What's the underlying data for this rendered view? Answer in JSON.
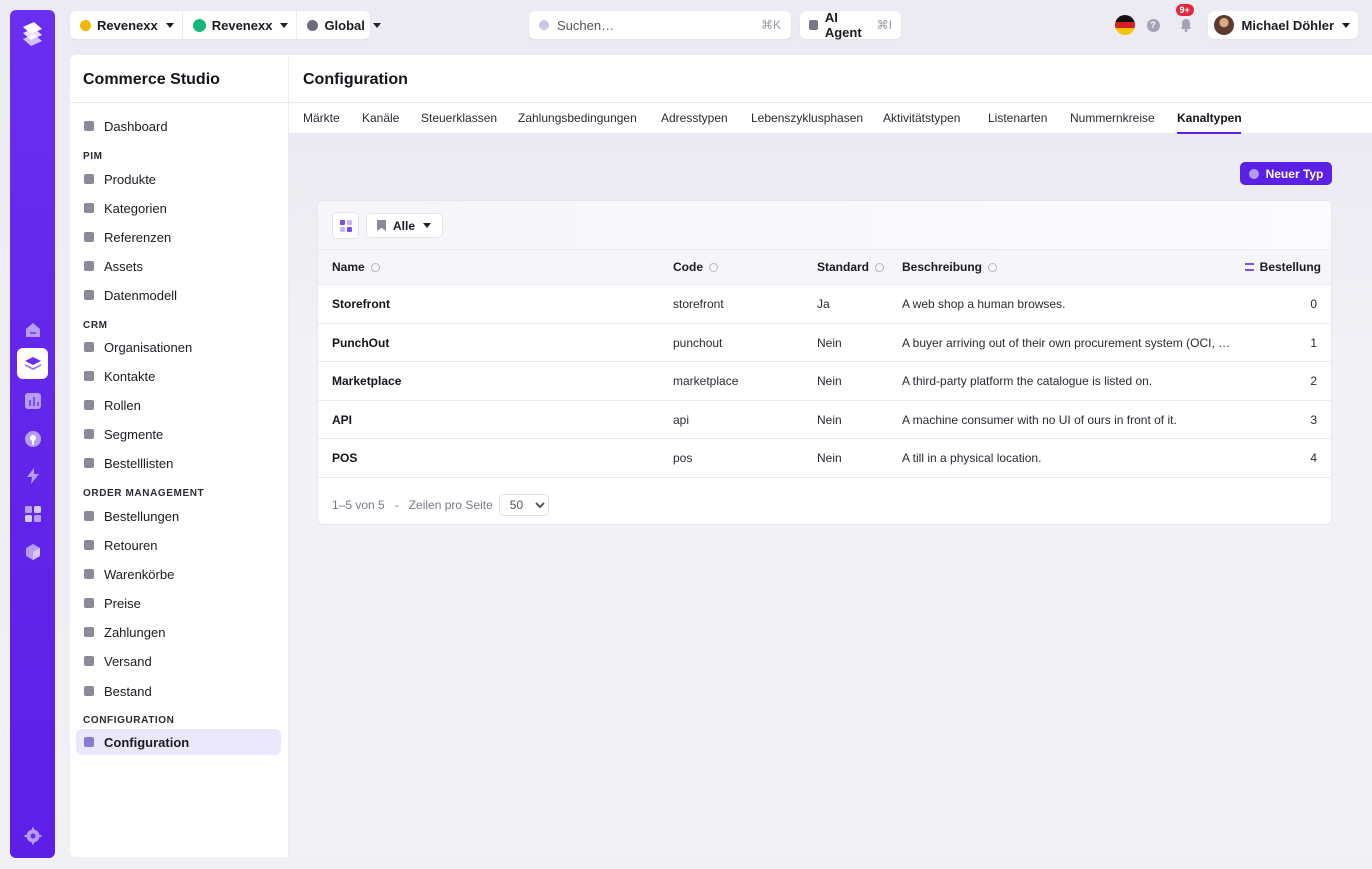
{
  "topbar": {
    "context": [
      {
        "label": "Revenexx",
        "color": "#f2b705"
      },
      {
        "label": "Revenexx",
        "color": "#14b87a"
      },
      {
        "label": "Global",
        "color": "#6e6c7a"
      }
    ],
    "search_placeholder": "Suchen…",
    "search_shortcut": "⌘K",
    "agent_label": "AI Agent",
    "agent_shortcut": "⌘I",
    "notification_badge": "9+",
    "help_icon": "?",
    "user_name": "Michael Döhler"
  },
  "sidebar": {
    "title": "Commerce Studio",
    "dashboard": "Dashboard",
    "sections": [
      {
        "heading": "PIM",
        "items": [
          "Produkte",
          "Kategorien",
          "Referenzen",
          "Assets",
          "Datenmodell"
        ]
      },
      {
        "heading": "CRM",
        "items": [
          "Organisationen",
          "Kontakte",
          "Rollen",
          "Segmente",
          "Bestelllisten"
        ]
      },
      {
        "heading": "ORDER MANAGEMENT",
        "items": [
          "Bestellungen",
          "Retouren",
          "Warenkörbe",
          "Preise",
          "Zahlungen",
          "Versand",
          "Bestand"
        ]
      },
      {
        "heading": "CONFIGURATION",
        "items": [
          "Configuration"
        ]
      }
    ]
  },
  "page": {
    "title": "Configuration",
    "tabs": [
      "Märkte",
      "Kanäle",
      "Steuerklassen",
      "Zahlungsbedingungen",
      "Adresstypen",
      "Lebenszyklusphasen",
      "Aktivitätstypen",
      "Listenarten",
      "Nummernkreise",
      "Kanaltypen"
    ],
    "active_tab": "Kanaltypen",
    "new_button": "Neuer Typ",
    "filter_label": "Alle"
  },
  "table": {
    "columns": {
      "name": "Name",
      "code": "Code",
      "standard": "Standard",
      "description": "Beschreibung",
      "order": "Bestellung"
    },
    "rows": [
      {
        "name": "Storefront",
        "code": "storefront",
        "standard": "Ja",
        "description": "A web shop a human browses.",
        "order": "0"
      },
      {
        "name": "PunchOut",
        "code": "punchout",
        "standard": "Nein",
        "description": "A buyer arriving out of their own procurement system (OCI, c...",
        "order": "1"
      },
      {
        "name": "Marketplace",
        "code": "marketplace",
        "standard": "Nein",
        "description": "A third-party platform the catalogue is listed on.",
        "order": "2"
      },
      {
        "name": "API",
        "code": "api",
        "standard": "Nein",
        "description": "A machine consumer with no UI of ours in front of it.",
        "order": "3"
      },
      {
        "name": "POS",
        "code": "pos",
        "standard": "Nein",
        "description": "A till in a physical location.",
        "order": "4"
      }
    ],
    "pagination": {
      "range": "1–5 von 5",
      "separator": "-",
      "rows_label": "Zeilen pro Seite",
      "rows_value": "50"
    }
  },
  "colors": {
    "accent": "#5b1fe6",
    "rail": "#6a2ef0"
  }
}
